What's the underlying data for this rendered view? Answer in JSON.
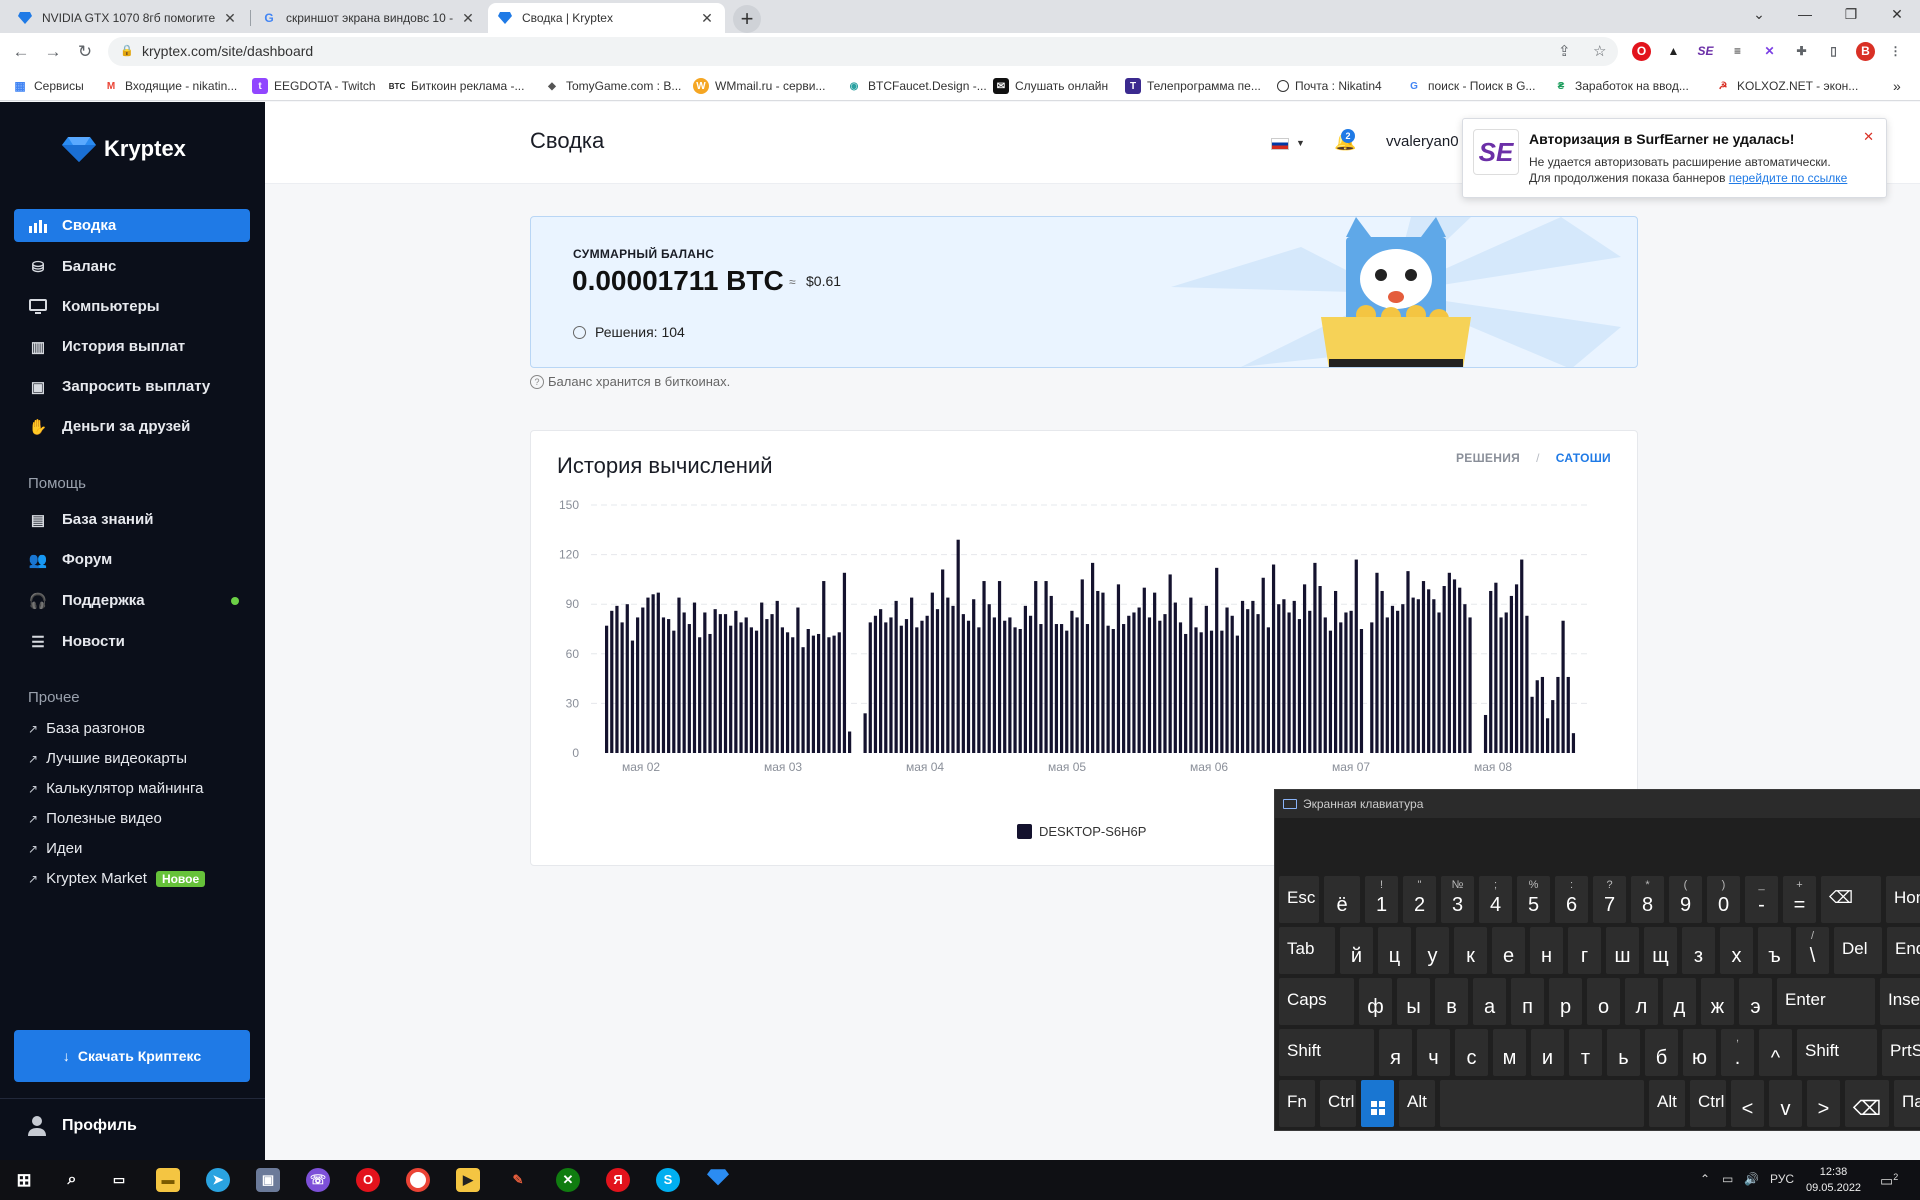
{
  "browser": {
    "tabs": [
      {
        "title": "NVIDIA GTX 1070 8гб помогите"
      },
      {
        "title": "скриншот экрана виндовс 10 -"
      },
      {
        "title": "Сводка | Kryptex"
      }
    ],
    "url": "kryptex.com/site/dashboard",
    "bookmarks": [
      {
        "label": "Сервисы"
      },
      {
        "label": "Входящие - nikatin..."
      },
      {
        "label": "EEGDOTA - Twitch"
      },
      {
        "label": "Биткоин реклама -..."
      },
      {
        "label": "TomyGame.com : B..."
      },
      {
        "label": "WMmail.ru - серви..."
      },
      {
        "label": "BTCFaucet.Design -..."
      },
      {
        "label": "Слушать онлайн"
      },
      {
        "label": "Телепрограмма пе..."
      },
      {
        "label": "Почта : Nikatin4"
      },
      {
        "label": "поиск - Поиск в G..."
      },
      {
        "label": "Заработок на ввод..."
      },
      {
        "label": "KOLXOZ.NET - экон..."
      }
    ],
    "profile_initial": "В"
  },
  "sidebar": {
    "logo": "Kryptex",
    "nav": [
      {
        "label": "Сводка",
        "icon": "bar-chart-icon"
      },
      {
        "label": "Баланс",
        "icon": "coins-icon"
      },
      {
        "label": "Компьютеры",
        "icon": "monitor-icon"
      },
      {
        "label": "История выплат",
        "icon": "history-icon"
      },
      {
        "label": "Запросить выплату",
        "icon": "wallet-icon"
      },
      {
        "label": "Деньги за друзей",
        "icon": "gift-icon"
      }
    ],
    "help_title": "Помощь",
    "help": [
      {
        "label": "База знаний",
        "icon": "book-icon"
      },
      {
        "label": "Форум",
        "icon": "users-icon"
      },
      {
        "label": "Поддержка",
        "icon": "headset-icon"
      },
      {
        "label": "Новости",
        "icon": "news-icon"
      }
    ],
    "other_title": "Прочее",
    "other": [
      {
        "label": "База разгонов"
      },
      {
        "label": "Лучшие видеокарты"
      },
      {
        "label": "Калькулятор майнинга"
      },
      {
        "label": "Полезные видео"
      },
      {
        "label": "Идеи"
      },
      {
        "label": "Kryptex Market"
      }
    ],
    "new_badge": "Новое",
    "download": "Скачать Криптекс",
    "profile": "Профиль"
  },
  "header": {
    "title": "Сводка",
    "notifications": "2",
    "username": "vvaleryan0"
  },
  "balance": {
    "label": "СУММАРНЫЙ БАЛАНС",
    "value": "0.00001711 BTC",
    "approx": "≈",
    "usd": "$0.61",
    "solutions": "Решения: 104",
    "note": "Баланс хранится в биткоинах."
  },
  "history": {
    "title": "История вычислений",
    "toggle_a": "РЕШЕНИЯ",
    "toggle_sep": "/",
    "toggle_b": "САТОШИ"
  },
  "chart_data": {
    "type": "bar",
    "yticks": [
      0,
      30,
      60,
      90,
      120,
      150
    ],
    "ylim": [
      0,
      150
    ],
    "xticks": [
      "мая 02",
      "мая 03",
      "мая 04",
      "мая 05",
      "мая 06",
      "мая 07",
      "мая 08"
    ],
    "grid": true,
    "legend": "bottom",
    "color": "#14122e",
    "series": [
      {
        "name": "DESKTOP-S6H6P",
        "values": [
          77,
          86,
          89,
          79,
          90,
          68,
          82,
          88,
          94,
          96,
          97,
          82,
          81,
          74,
          94,
          85,
          78,
          91,
          70,
          85,
          72,
          87,
          84,
          84,
          77,
          86,
          79,
          82,
          76,
          74,
          91,
          81,
          84,
          92,
          76,
          73,
          70,
          88,
          64,
          75,
          71,
          72,
          104,
          70,
          71,
          73,
          109,
          13,
          0,
          0,
          24,
          79,
          83,
          87,
          79,
          82,
          92,
          77,
          81,
          94,
          76,
          80,
          83,
          97,
          87,
          111,
          94,
          89,
          129,
          84,
          80,
          93,
          76,
          104,
          90,
          82,
          104,
          80,
          82,
          76,
          75,
          89,
          83,
          104,
          78,
          104,
          95,
          78,
          78,
          74,
          86,
          82,
          105,
          78,
          115,
          98,
          97,
          77,
          75,
          102,
          78,
          83,
          85,
          88,
          100,
          82,
          97,
          80,
          84,
          108,
          91,
          79,
          72,
          94,
          76,
          73,
          89,
          74,
          112,
          74,
          88,
          83,
          71,
          92,
          87,
          92,
          84,
          106,
          76,
          114,
          90,
          93,
          85,
          92,
          81,
          102,
          86,
          115,
          101,
          82,
          74,
          98,
          79,
          85,
          86,
          117,
          75,
          0,
          79,
          109,
          98,
          82,
          89,
          86,
          90,
          110,
          94,
          93,
          104,
          99,
          93,
          85,
          101,
          109,
          105,
          100,
          90,
          82,
          0,
          0,
          23,
          98,
          103,
          82,
          85,
          95,
          102,
          117,
          83,
          34,
          44,
          46,
          21,
          32,
          46,
          80,
          46,
          12
        ]
      }
    ]
  },
  "notification": {
    "title": "Авторизация в SurfEarner не удалась!",
    "line1": "Не удается авторизовать расширение автоматически.",
    "line2": "Для продолжения показа баннеров",
    "link": "перейдите по ссылке",
    "logo": "SE"
  },
  "keyboard": {
    "title": "Экранная клавиатура",
    "rows": [
      [
        {
          "m": "Esc",
          "w": 40,
          "fn": true
        },
        {
          "m": "ё",
          "w": 36
        },
        {
          "s": "!",
          "m": "1",
          "w": 33
        },
        {
          "s": "\"",
          "m": "2",
          "w": 33
        },
        {
          "s": "№",
          "m": "3",
          "w": 33
        },
        {
          "s": ";",
          "m": "4",
          "w": 33
        },
        {
          "s": "%",
          "m": "5",
          "w": 33
        },
        {
          "s": ":",
          "m": "6",
          "w": 33
        },
        {
          "s": "?",
          "m": "7",
          "w": 33
        },
        {
          "s": "*",
          "m": "8",
          "w": 33
        },
        {
          "s": "(",
          "m": "9",
          "w": 33
        },
        {
          "s": ")",
          "m": "0",
          "w": 33
        },
        {
          "s": "_",
          "m": "-",
          "w": 33
        },
        {
          "s": "+",
          "m": "=",
          "w": 33
        },
        {
          "m": "⌫",
          "w": 60,
          "fn": true
        },
        {
          "m": "Hon",
          "w": 44,
          "fn": true
        }
      ],
      [
        {
          "m": "Tab",
          "w": 56,
          "fn": true
        },
        {
          "m": "й",
          "w": 33
        },
        {
          "m": "ц",
          "w": 33
        },
        {
          "m": "у",
          "w": 33
        },
        {
          "m": "к",
          "w": 33
        },
        {
          "m": "е",
          "w": 33
        },
        {
          "m": "н",
          "w": 33
        },
        {
          "m": "г",
          "w": 33
        },
        {
          "m": "ш",
          "w": 33
        },
        {
          "m": "щ",
          "w": 33
        },
        {
          "m": "з",
          "w": 33
        },
        {
          "m": "х",
          "w": 33
        },
        {
          "m": "ъ",
          "w": 33
        },
        {
          "s": "/",
          "m": "\\",
          "w": 33
        },
        {
          "m": "Del",
          "w": 48,
          "fn": true
        },
        {
          "m": "End",
          "w": 44,
          "fn": true
        }
      ],
      [
        {
          "m": "Caps",
          "w": 75,
          "fn": true
        },
        {
          "m": "ф",
          "w": 33
        },
        {
          "m": "ы",
          "w": 33
        },
        {
          "m": "в",
          "w": 33
        },
        {
          "m": "а",
          "w": 33
        },
        {
          "m": "п",
          "w": 33
        },
        {
          "m": "р",
          "w": 33
        },
        {
          "m": "о",
          "w": 33
        },
        {
          "m": "л",
          "w": 33
        },
        {
          "m": "д",
          "w": 33
        },
        {
          "m": "ж",
          "w": 33
        },
        {
          "m": "э",
          "w": 33
        },
        {
          "m": "Enter",
          "w": 98,
          "fn": true
        },
        {
          "m": "Inse",
          "w": 44,
          "fn": true
        }
      ],
      [
        {
          "m": "Shift",
          "w": 95,
          "fn": true
        },
        {
          "m": "я",
          "w": 33
        },
        {
          "m": "ч",
          "w": 33
        },
        {
          "m": "с",
          "w": 33
        },
        {
          "m": "м",
          "w": 33
        },
        {
          "m": "и",
          "w": 33
        },
        {
          "m": "т",
          "w": 33
        },
        {
          "m": "ь",
          "w": 33
        },
        {
          "m": "б",
          "w": 33
        },
        {
          "m": "ю",
          "w": 33
        },
        {
          "s": ",",
          "m": ".",
          "w": 33
        },
        {
          "m": "^",
          "w": 33
        },
        {
          "m": "Shift",
          "w": 80,
          "fn": true
        },
        {
          "m": "PrtS",
          "w": 44,
          "fn": true
        }
      ],
      [
        {
          "m": "Fn",
          "w": 36,
          "fn": true
        },
        {
          "m": "Ctrl",
          "w": 36,
          "fn": true
        },
        {
          "m": "",
          "w": 33,
          "win": true
        },
        {
          "m": "Alt",
          "w": 36,
          "fn": true
        },
        {
          "m": "",
          "w": 204
        },
        {
          "m": "Alt",
          "w": 36,
          "fn": true
        },
        {
          "m": "Ctrl",
          "w": 36,
          "fn": true
        },
        {
          "m": "<",
          "w": 33
        },
        {
          "m": "v",
          "w": 33
        },
        {
          "m": ">",
          "w": 33
        },
        {
          "m": "⌫",
          "w": 44
        },
        {
          "m": "Парам",
          "w": 44,
          "fn": true
        }
      ]
    ]
  },
  "taskbar": {
    "lang": "РУС",
    "time": "12:38",
    "date": "09.05.2022",
    "notif_count": "2"
  },
  "colors": {
    "accent": "#1f7ae6",
    "sidebar_bg": "#0b0f1a",
    "bar": "#14122e",
    "card_bg": "#eaf4ff"
  }
}
